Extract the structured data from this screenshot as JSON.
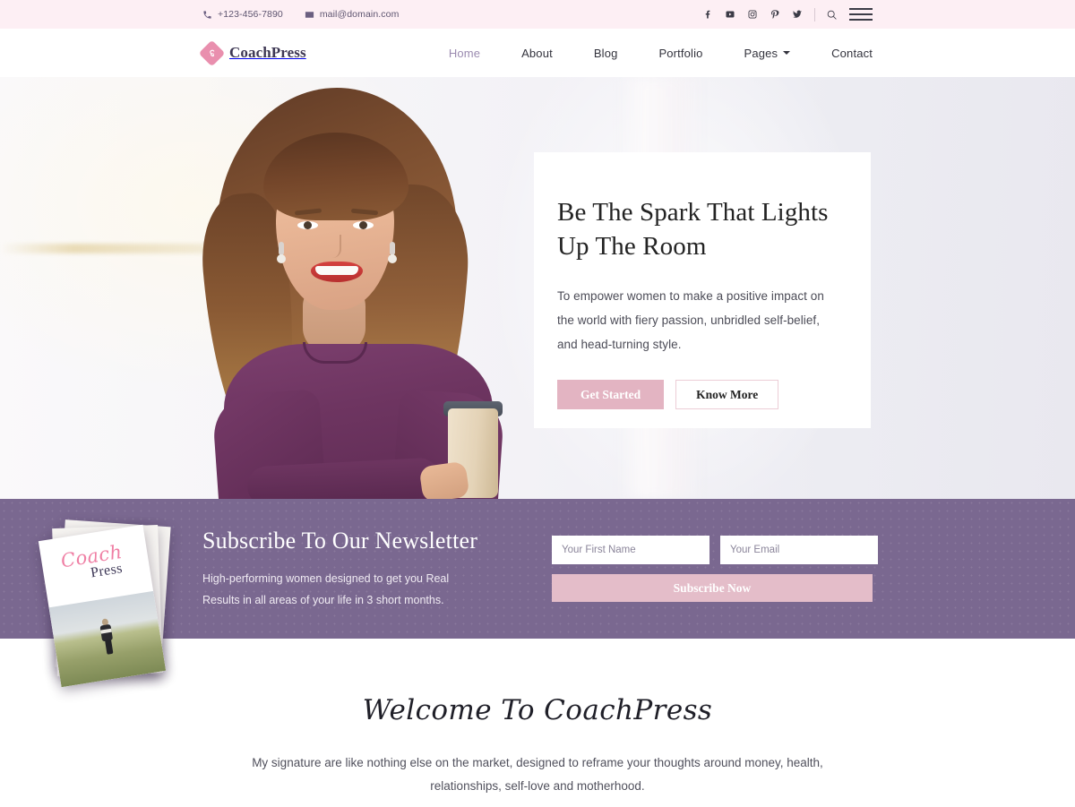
{
  "topbar": {
    "phone": "+123-456-7890",
    "email": "mail@domain.com",
    "phone_icon": "phone-icon",
    "email_icon": "envelope-icon",
    "socials": [
      {
        "name": "facebook-icon",
        "label": "Facebook"
      },
      {
        "name": "youtube-icon",
        "label": "YouTube"
      },
      {
        "name": "instagram-icon",
        "label": "Instagram"
      },
      {
        "name": "pinterest-icon",
        "label": "Pinterest"
      },
      {
        "name": "twitter-icon",
        "label": "Twitter"
      }
    ],
    "search_icon": "search-icon",
    "menu_icon": "hamburger-menu-icon",
    "background": "#fdeff4"
  },
  "header": {
    "logo_text": "CoachPress",
    "logo_icon": "coachpress-diamond-logo-icon",
    "nav": [
      {
        "label": "Home",
        "active": true,
        "dropdown": false
      },
      {
        "label": "About",
        "active": false,
        "dropdown": false
      },
      {
        "label": "Blog",
        "active": false,
        "dropdown": false
      },
      {
        "label": "Portfolio",
        "active": false,
        "dropdown": false
      },
      {
        "label": "Pages",
        "active": false,
        "dropdown": true
      },
      {
        "label": "Contact",
        "active": false,
        "dropdown": false
      }
    ]
  },
  "hero": {
    "heading": "Be The Spark That Lights Up The Room",
    "paragraph": "To empower women to make a positive impact on the world with fiery passion, unbridled self-belief, and head-turning style.",
    "primary_button": "Get Started",
    "secondary_button": "Know More",
    "image_alt": "smiling woman in purple sweater holding coffee cup"
  },
  "newsletter": {
    "heading": "Subscribe To Our Newsletter",
    "paragraph": "High-performing women designed to get you Real Results in all areas of your life in 3 short months.",
    "first_name_placeholder": "Your First Name",
    "first_name_value": "",
    "email_placeholder": "Your Email",
    "email_value": "",
    "submit_label": "Subscribe Now",
    "background": "#7a6890",
    "book": {
      "title_script": "Coach",
      "title_serif": "Press",
      "image_alt": "person walking on grassy hillside"
    }
  },
  "welcome": {
    "title": "Welcome To CoachPress",
    "paragraph": "My signature are like nothing else on the market, designed to reframe your thoughts around money, health, relationships, self-love and motherhood."
  },
  "colors": {
    "pink": "#e3b4c2",
    "pink_light": "#fdeff4",
    "purple": "#7a6890",
    "logo_pink": "#e98fae",
    "nav_active": "#9b8bb0"
  }
}
